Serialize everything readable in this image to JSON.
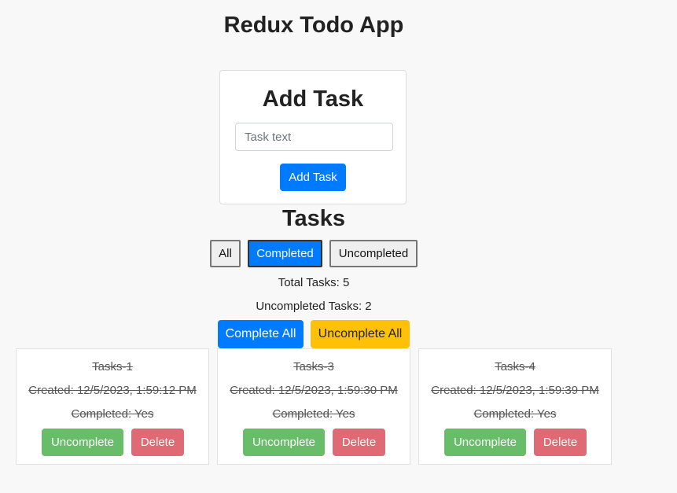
{
  "app": {
    "title": "Redux Todo App"
  },
  "add_task": {
    "heading": "Add Task",
    "input_placeholder": "Task text",
    "input_value": "",
    "button_label": "Add Task"
  },
  "tasks_section": {
    "heading": "Tasks",
    "filters": [
      {
        "label": "All",
        "active": false
      },
      {
        "label": "Completed",
        "active": true
      },
      {
        "label": "Uncompleted",
        "active": false
      }
    ],
    "total_tasks": "Total Tasks: 5",
    "uncompleted_tasks": "Uncompleted Tasks: 2",
    "complete_all_label": "Complete All",
    "uncomplete_all_label": "Uncomplete All"
  },
  "tasks": [
    {
      "title": "Tasks-1",
      "created": "Created: 12/5/2023, 1:59:12 PM",
      "completed": "Completed: Yes",
      "toggle_label": "Uncomplete",
      "delete_label": "Delete"
    },
    {
      "title": "Tasks-3",
      "created": "Created: 12/5/2023, 1:59:30 PM",
      "completed": "Completed: Yes",
      "toggle_label": "Uncomplete",
      "delete_label": "Delete"
    },
    {
      "title": "Tasks-4",
      "created": "Created: 12/5/2023, 1:59:39 PM",
      "completed": "Completed: Yes",
      "toggle_label": "Uncomplete",
      "delete_label": "Delete"
    }
  ],
  "colors": {
    "primary": "#007bff",
    "warning": "#ffc107",
    "success": "#5cb85c",
    "danger": "#e06a74"
  }
}
